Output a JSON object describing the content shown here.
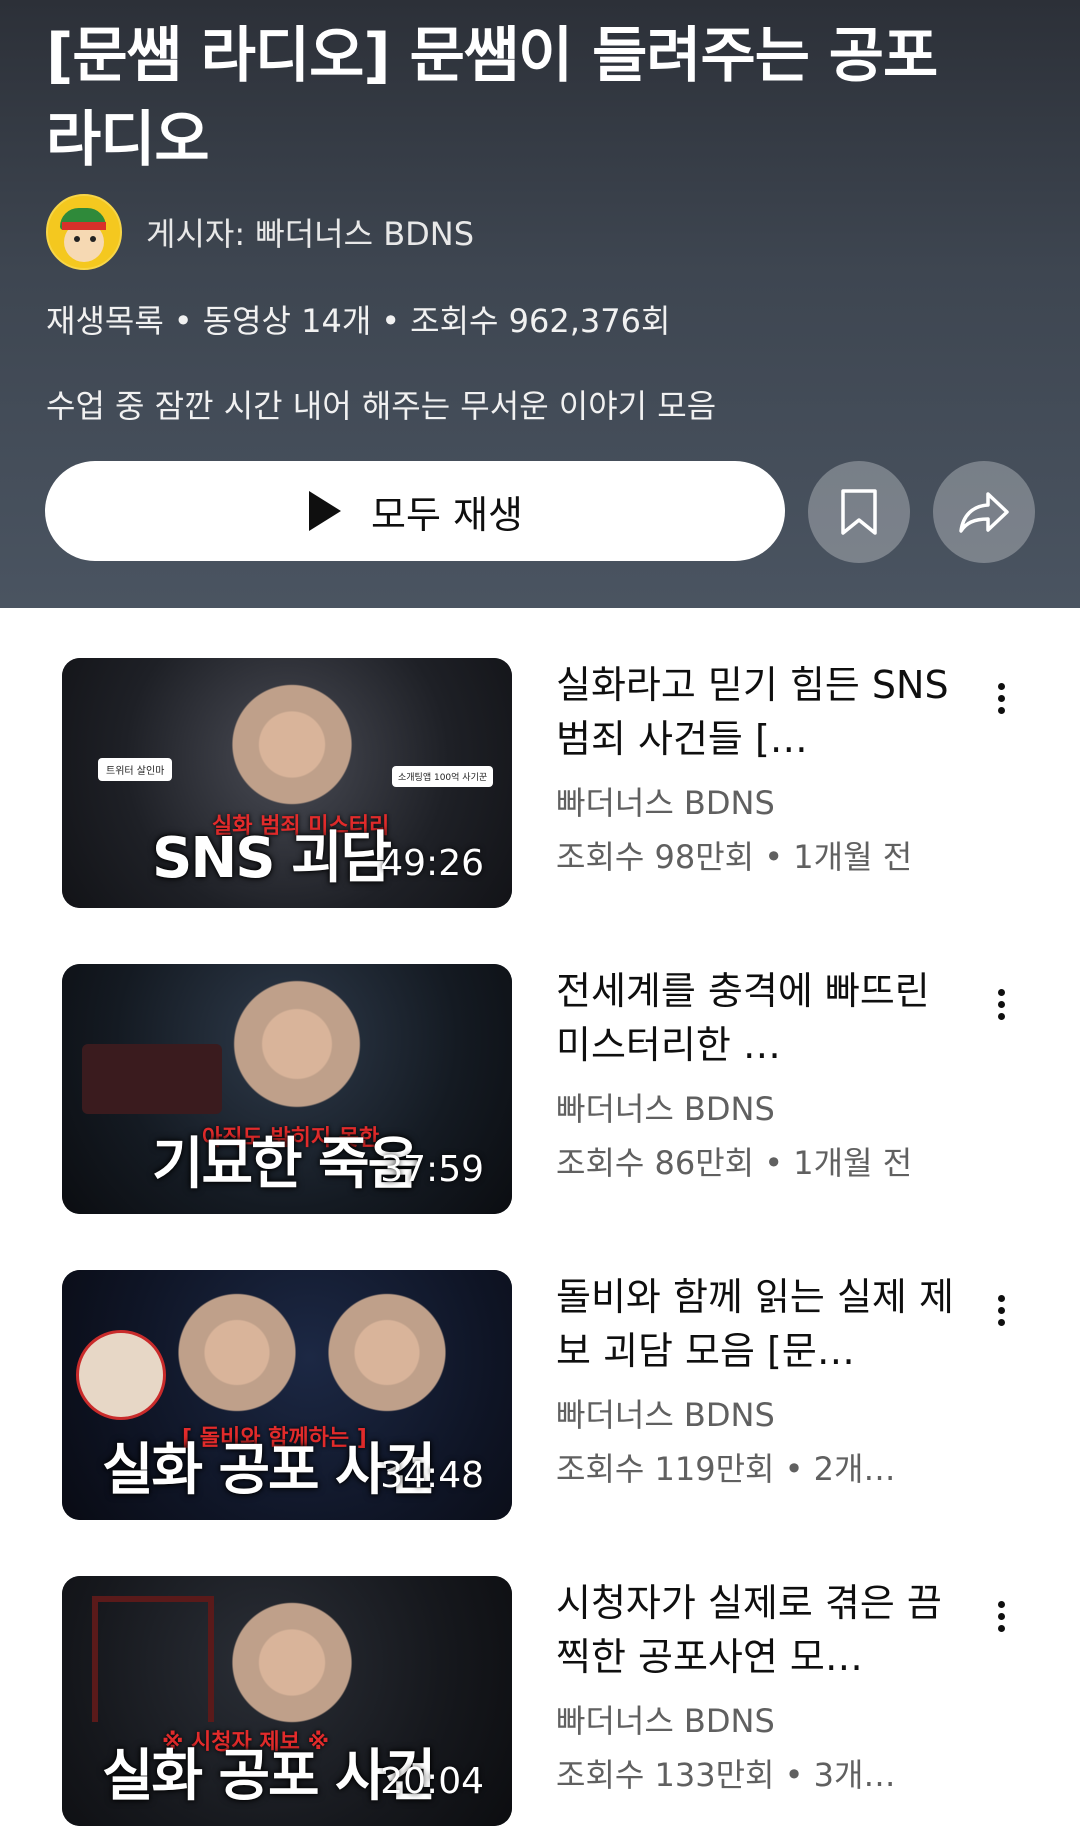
{
  "playlist": {
    "title": "[문쌤 라디오] 문쌤이 들려주는 공포 라디오",
    "author": "게시자: 빠더너스 BDNS",
    "meta": [
      "재생목록",
      "동영상 14개",
      "조회수 962,376회"
    ],
    "description": "수업 중 잠깐 시간 내어 해주는 무서운 이야기 모음",
    "play_all_label": "모두 재생",
    "save_icon": "bookmark-icon",
    "share_icon": "share-icon"
  },
  "videos": [
    {
      "title": "실화라고 믿기 힘든 SNS 범죄 사건들 […",
      "channel": "빠더너스 BDNS",
      "stats": "조회수 98만회 • 1개월 전",
      "duration": "49:26",
      "thumb_caption": "SNS 괴담",
      "thumb_tag": "실화 범죄 미스터리",
      "thumb_label_1": "트위터 살인마",
      "thumb_label_2": "소개팅앱 100억 사기꾼"
    },
    {
      "title": "전세계를 충격에 빠뜨린 미스터리한 …",
      "channel": "빠더너스 BDNS",
      "stats": "조회수 86만회 • 1개월 전",
      "duration": "37:59",
      "thumb_caption": "기묘한 죽음",
      "thumb_tag": "아직도 밝히지 못한"
    },
    {
      "title": "돌비와 함께 읽는 실제 제보 괴담 모음 [문…",
      "channel": "빠더너스 BDNS",
      "stats": "조회수 119만회 • 2개…",
      "duration": "34:48",
      "thumb_caption": "실화 공포 사건",
      "thumb_tag": "[ 돌비와 함께하는 ]"
    },
    {
      "title": "시청자가 실제로 겪은 끔찍한 공포사연 모…",
      "channel": "빠더너스 BDNS",
      "stats": "조회수 133만회 • 3개…",
      "duration": "20:04",
      "thumb_caption": "실화 공포 사건",
      "thumb_tag": "※ 시청자 제보 ※"
    }
  ]
}
